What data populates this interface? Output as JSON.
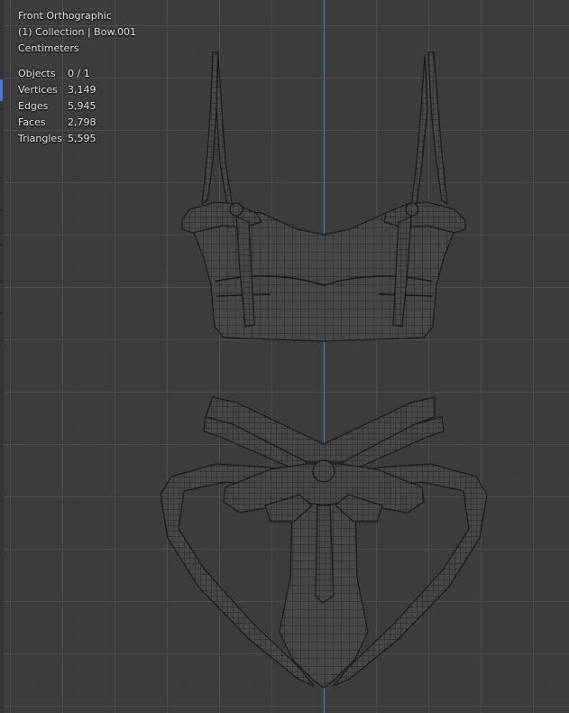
{
  "viewport": {
    "view_name": "Front Orthographic",
    "collection_label": "(1) Collection | Bow.001",
    "units": "Centimeters",
    "axis_color": "#4a7bd0"
  },
  "stats": [
    {
      "label": "Objects",
      "value": "0 / 1"
    },
    {
      "label": "Vertices",
      "value": "3,149"
    },
    {
      "label": "Edges",
      "value": "5,945"
    },
    {
      "label": "Faces",
      "value": "2,798"
    },
    {
      "label": "Triangles",
      "value": "5,595"
    }
  ]
}
